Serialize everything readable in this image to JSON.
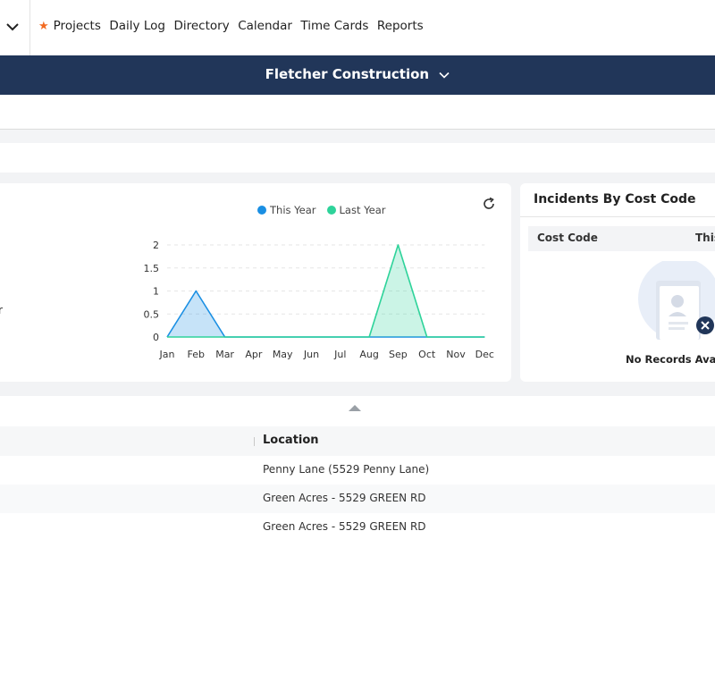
{
  "nav": {
    "items": [
      "Projects",
      "Daily Log",
      "Directory",
      "Calendar",
      "Time Cards",
      "Reports"
    ]
  },
  "header": {
    "company": "Fletcher Construction"
  },
  "chart_data": {
    "type": "area",
    "categories": [
      "Jan",
      "Feb",
      "Mar",
      "Apr",
      "May",
      "Jun",
      "Jul",
      "Aug",
      "Sep",
      "Oct",
      "Nov",
      "Dec"
    ],
    "series": [
      {
        "name": "This Year",
        "color": "#1a8fe3",
        "values": [
          0,
          1,
          0,
          0,
          0,
          0,
          0,
          0,
          0,
          0,
          0,
          0
        ]
      },
      {
        "name": "Last Year",
        "color": "#2ed39a",
        "values": [
          0,
          0,
          0,
          0,
          0,
          0,
          0,
          0,
          2,
          0,
          0,
          0
        ]
      }
    ],
    "y_ticks": [
      "0",
      "0.5",
      "1",
      "1.5",
      "2"
    ],
    "ylim": [
      0,
      2
    ],
    "grid": true,
    "legend": "top"
  },
  "edge_text": "r",
  "incidents": {
    "title": "Incidents By Cost Code",
    "columns": [
      "Cost Code",
      "This"
    ],
    "empty_text": "No Records Availa"
  },
  "table": {
    "header": "Location",
    "rows": [
      "Penny Lane (5529 Penny Lane)",
      "Green Acres - 5529 GREEN RD",
      "Green Acres - 5529 GREEN RD"
    ]
  }
}
